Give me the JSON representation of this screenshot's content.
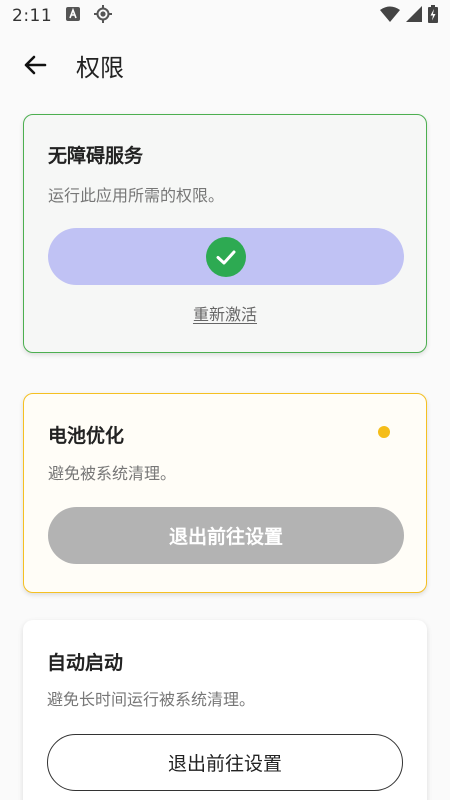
{
  "status_bar": {
    "time": "2:11"
  },
  "header": {
    "title": "权限"
  },
  "permissions": {
    "accessibility": {
      "title": "无障碍服务",
      "description": "运行此应用所需的权限。",
      "status": "granted",
      "link_label": "重新激活",
      "accent_color": "#4caf50"
    },
    "battery": {
      "title": "电池优化",
      "description": "避免被系统清理。",
      "button_label": "退出前往设置",
      "accent_color": "#f5c022"
    },
    "autostart": {
      "title": "自动启动",
      "description": "避免长时间运行被系统清理。",
      "button_label": "退出前往设置"
    }
  },
  "colors": {
    "pill_active": "#c0c2f4",
    "check_green": "#2daa52",
    "button_disabled": "#b3b3b3"
  }
}
